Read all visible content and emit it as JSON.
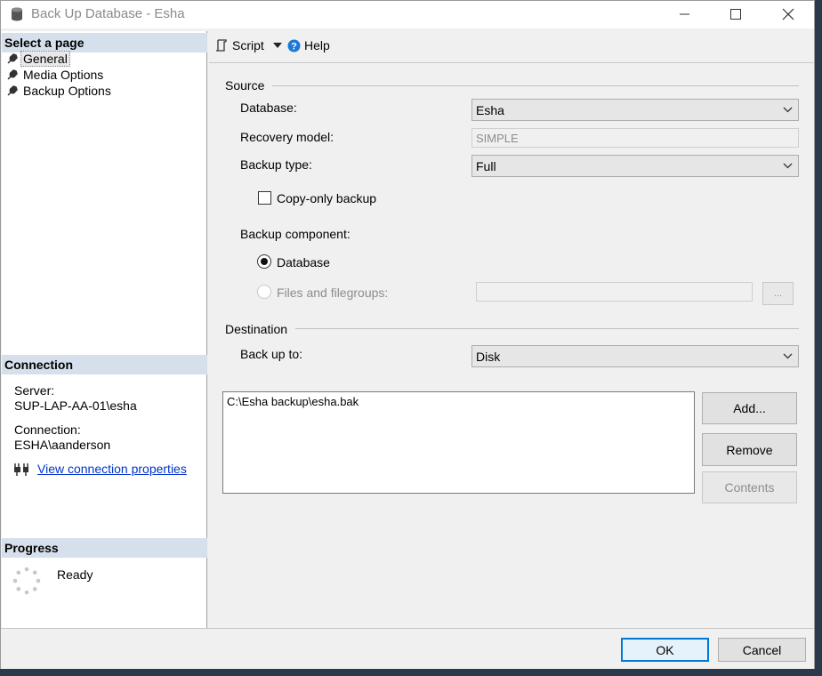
{
  "window": {
    "title": "Back Up Database - Esha"
  },
  "left": {
    "select_page": "Select a page",
    "pages": [
      {
        "label": "General"
      },
      {
        "label": "Media Options"
      },
      {
        "label": "Backup Options"
      }
    ],
    "connection_header": "Connection",
    "server_label": "Server:",
    "server_value": "SUP-LAP-AA-01\\esha",
    "connection_label": "Connection:",
    "connection_value": "ESHA\\aanderson",
    "view_props_link": "View connection properties",
    "progress_header": "Progress",
    "progress_status": "Ready"
  },
  "toolbar": {
    "script_label": "Script",
    "help_label": "Help"
  },
  "source": {
    "group_label": "Source",
    "database_label": "Database:",
    "database_value": "Esha",
    "recovery_label": "Recovery model:",
    "recovery_value": "SIMPLE",
    "backup_type_label": "Backup type:",
    "backup_type_value": "Full",
    "copy_only_label": "Copy-only backup",
    "component_label": "Backup component:",
    "radio_database_label": "Database",
    "radio_files_label": "Files and filegroups:",
    "browse_label": "..."
  },
  "destination": {
    "group_label": "Destination",
    "back_up_to_label": "Back up to:",
    "back_up_to_value": "Disk",
    "paths": [
      "C:\\Esha backup\\esha.bak"
    ],
    "add_label": "Add...",
    "remove_label": "Remove",
    "contents_label": "Contents"
  },
  "footer": {
    "ok_label": "OK",
    "cancel_label": "Cancel"
  }
}
